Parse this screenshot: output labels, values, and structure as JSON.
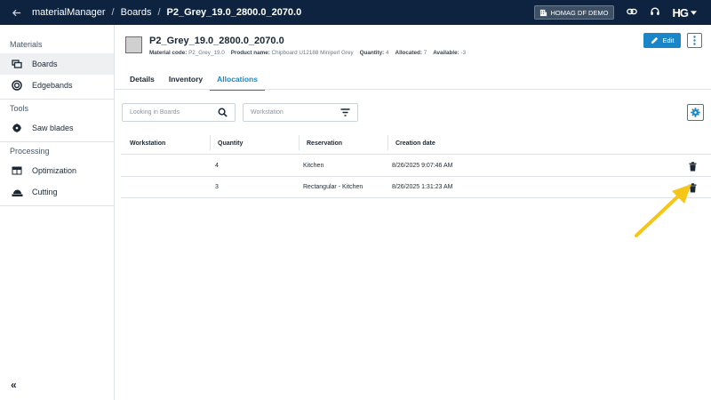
{
  "topbar": {
    "breadcrumbs": [
      "materialManager",
      "Boards",
      "P2_Grey_19.0_2800.0_2070.0"
    ],
    "separator": "/",
    "tenant": "HOMAG DF DEMO",
    "logo": "HG"
  },
  "sidebar": {
    "sections": [
      {
        "title": "Materials",
        "items": [
          {
            "label": "Boards",
            "icon": "boards-icon",
            "active": true
          },
          {
            "label": "Edgebands",
            "icon": "edgeband-roll-icon"
          }
        ]
      },
      {
        "title": "Tools",
        "items": [
          {
            "label": "Saw blades",
            "icon": "saw-blade-icon"
          }
        ]
      },
      {
        "title": "Processing",
        "items": [
          {
            "label": "Optimization",
            "icon": "optimization-icon"
          },
          {
            "label": "Cutting",
            "icon": "cutting-icon"
          }
        ]
      }
    ],
    "collapse_label": "«"
  },
  "header": {
    "title": "P2_Grey_19.0_2800.0_2070.0",
    "meta": [
      {
        "label": "Material code:",
        "value": "P2_Grey_19.0"
      },
      {
        "label": "Product name:",
        "value": "Chipboard U12188 Miniperl Grey"
      },
      {
        "label": "Quantity:",
        "value": "4"
      },
      {
        "label": "Allocated:",
        "value": "7"
      },
      {
        "label": "Available:",
        "value": "-3"
      }
    ],
    "edit_label": "Edit"
  },
  "tabs": [
    "Details",
    "Inventory",
    "Allocations"
  ],
  "active_tab": "Allocations",
  "filters": {
    "boards_placeholder": "Looking in Boards",
    "workstation_placeholder": "Workstation"
  },
  "table": {
    "columns": [
      "Workstation",
      "Quantity",
      "Reservation",
      "Creation date"
    ],
    "rows": [
      {
        "workstation": "",
        "quantity": "4",
        "reservation": "Kitchen",
        "created": "8/26/2025 9:07:46 AM"
      },
      {
        "workstation": "",
        "quantity": "3",
        "reservation": "Rectangular - Kitchen",
        "created": "8/26/2025 1:31:23 AM"
      }
    ]
  },
  "colors": {
    "accent": "#1a86c7",
    "topbar": "#0d2340",
    "annotation": "#f5c518"
  }
}
